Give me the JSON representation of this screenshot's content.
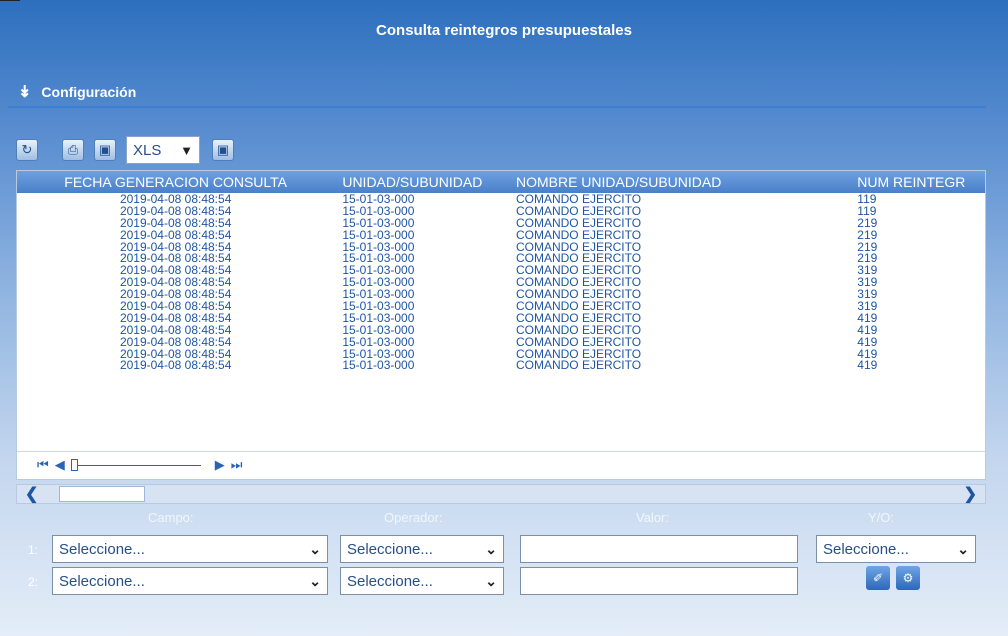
{
  "title": "Consulta reintegros presupuestales",
  "config_label": "Configuración",
  "toolbar": {
    "export_format": "XLS"
  },
  "table": {
    "columns": [
      "FECHA GENERACION CONSULTA",
      "UNIDAD/SUBUNIDAD",
      "NOMBRE UNIDAD/SUBUNIDAD",
      "NUM REINTEGR"
    ],
    "rows": [
      [
        "2019-04-08 08:48:54",
        "15-01-03-000",
        "COMANDO EJERCITO",
        "119"
      ],
      [
        "2019-04-08 08:48:54",
        "15-01-03-000",
        "COMANDO EJERCITO",
        "119"
      ],
      [
        "2019-04-08 08:48:54",
        "15-01-03-000",
        "COMANDO EJERCITO",
        "219"
      ],
      [
        "2019-04-08 08:48:54",
        "15-01-03-000",
        "COMANDO EJERCITO",
        "219"
      ],
      [
        "2019-04-08 08:48:54",
        "15-01-03-000",
        "COMANDO EJERCITO",
        "219"
      ],
      [
        "2019-04-08 08:48:54",
        "15-01-03-000",
        "COMANDO EJERCITO",
        "219"
      ],
      [
        "2019-04-08 08:48:54",
        "15-01-03-000",
        "COMANDO EJERCITO",
        "319"
      ],
      [
        "2019-04-08 08:48:54",
        "15-01-03-000",
        "COMANDO EJERCITO",
        "319"
      ],
      [
        "2019-04-08 08:48:54",
        "15-01-03-000",
        "COMANDO EJERCITO",
        "319"
      ],
      [
        "2019-04-08 08:48:54",
        "15-01-03-000",
        "COMANDO EJERCITO",
        "319"
      ],
      [
        "2019-04-08 08:48:54",
        "15-01-03-000",
        "COMANDO EJERCITO",
        "419"
      ],
      [
        "2019-04-08 08:48:54",
        "15-01-03-000",
        "COMANDO EJERCITO",
        "419"
      ],
      [
        "2019-04-08 08:48:54",
        "15-01-03-000",
        "COMANDO EJERCITO",
        "419"
      ],
      [
        "2019-04-08 08:48:54",
        "15-01-03-000",
        "COMANDO EJERCITO",
        "419"
      ],
      [
        "2019-04-08 08:48:54",
        "15-01-03-000",
        "COMANDO EJERCITO",
        "419"
      ]
    ]
  },
  "filters": {
    "labels": {
      "campo": "Campo:",
      "operador": "Operador:",
      "valor": "Valor:",
      "yo": "Y/O:"
    },
    "rows": [
      {
        "num": "1:",
        "campo": "Seleccione...",
        "operador": "Seleccione...",
        "valor": "",
        "yo": "Seleccione..."
      },
      {
        "num": "2:",
        "campo": "Seleccione...",
        "operador": "Seleccione...",
        "valor": ""
      }
    ]
  },
  "colors": {
    "header_blue": "#2d6fbe",
    "grid_header": "#5a8fd6",
    "cell_text": "#1f56a4"
  }
}
